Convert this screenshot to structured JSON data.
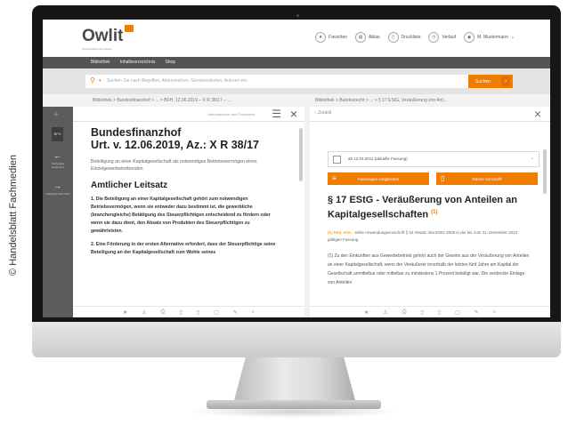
{
  "credit": "© Handelsblatt Fachmedien",
  "header": {
    "logo": "Owlit",
    "logo_sub": "Handelsblatt Fachmedien",
    "nav": [
      {
        "icon": "star-icon",
        "glyph": "★",
        "label": "Favoriten"
      },
      {
        "icon": "folder-icon",
        "glyph": "▤",
        "label": "Ablas"
      },
      {
        "icon": "bookmark-icon",
        "glyph": "▯",
        "label": "Druckliste"
      },
      {
        "icon": "history-icon",
        "glyph": "◷",
        "label": "Verlauf"
      },
      {
        "icon": "user-icon",
        "glyph": "◉",
        "label": "M. Mustermann"
      }
    ]
  },
  "menu": {
    "items": [
      "Bibliothek",
      "Inhaltsverzeichnis",
      "Shop"
    ]
  },
  "search": {
    "placeholder": "Suchen Sie nach Begriffen, Aktenzeichen, Gesetzestexten, Autoren etc.",
    "button": "Suchen"
  },
  "crumbs": {
    "left": "Bibliothek  >  Bundesfinanzhof  >  ...  >  BFH, 12.06.2019 – X R 38/17 – ...",
    "right": "Bibliothek  >  Bundesrecht  >  ...  >  § 17 EStG, Veräußerung von Ant..."
  },
  "sidebar": {
    "doc": "BFH",
    "prev": "Vorheriges Dokument",
    "next": "Nächstes Dokument"
  },
  "left_doc": {
    "info": "Informationen zum Dokument",
    "title1": "Bundesfinanzhof",
    "title2": "Urt. v. 12.06.2019, Az.: X R 38/17",
    "desc": "Beteiligung an einer Kapitalgesellschaft als notwendiges Betriebsvermögen eines Einzelgewerbetreibenden",
    "subtitle": "Amtlicher Leitsatz",
    "p1": "1. Die Beteiligung an einer Kapitalgesellschaft gehört zum notwendigen Betriebsvermögen, wenn sie entweder dazu bestimmt ist, die gewerbliche (branchengleiche) Betätigung des Steuerpflichtigen entscheidend zu fördern oder wenn sie dazu dient, den Absatz von Produkten des Steuerpflichtigen zu gewährleisten.",
    "p2": "2. Eine Förderung in der ersten Alternative erfordert, dass der Steuerpflichtige seine Beteiligung an der Kapitalgesellschaft zum Wohle seines"
  },
  "right_doc": {
    "back": "Zurück",
    "version": "ab 12.04.2011 (aktuelle Fassung)",
    "compare": "Fassungen vergleichen",
    "full": "Ganze Vorschrift",
    "title": "§ 17 EStG - Veräußerung von Anteilen an Kapitalgesellschaften",
    "footnote": "(1)",
    "note_label": "(1) Red. Anm.:",
    "note": "siehe Anwendungsvorschrift § 52 Absatz 3ea EStG 2009 in der bis zum 31. Dezember 2013 gültigen Fassung",
    "text": "(1) Zu den Einkünften aus Gewerbebetrieb gehört auch der Gewinn aus der Veräußerung von Anteilen an einer Kapitalgesellschaft, wenn der Veräußerer innerhalb der letzten fünf Jahre am Kapital der Gesellschaft unmittelbar oder mittelbar zu mindestens 1 Prozent beteiligt war. Die verdeckte Einlage von Anteilen"
  },
  "toolbar": [
    "★",
    "♙",
    "⎙",
    "▯",
    "▯",
    "▢",
    "✎",
    "⌕"
  ],
  "colors": {
    "accent": "#f07d00",
    "navbar": "#535455",
    "sidebar": "#5b5c5e"
  }
}
